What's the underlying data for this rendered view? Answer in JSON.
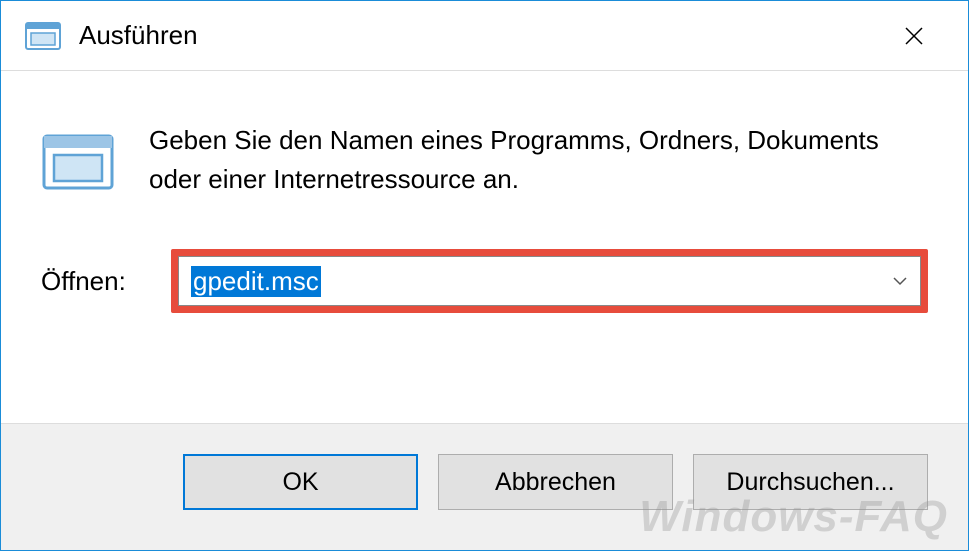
{
  "window": {
    "title": "Ausführen"
  },
  "content": {
    "description": "Geben Sie den Namen eines Programms, Ordners, Dokuments oder einer Internetressource an.",
    "open_label": "Öffnen:",
    "input_value": "gpedit.msc"
  },
  "buttons": {
    "ok": "OK",
    "cancel": "Abbrechen",
    "browse": "Durchsuchen..."
  },
  "watermark": "Windows-FAQ"
}
